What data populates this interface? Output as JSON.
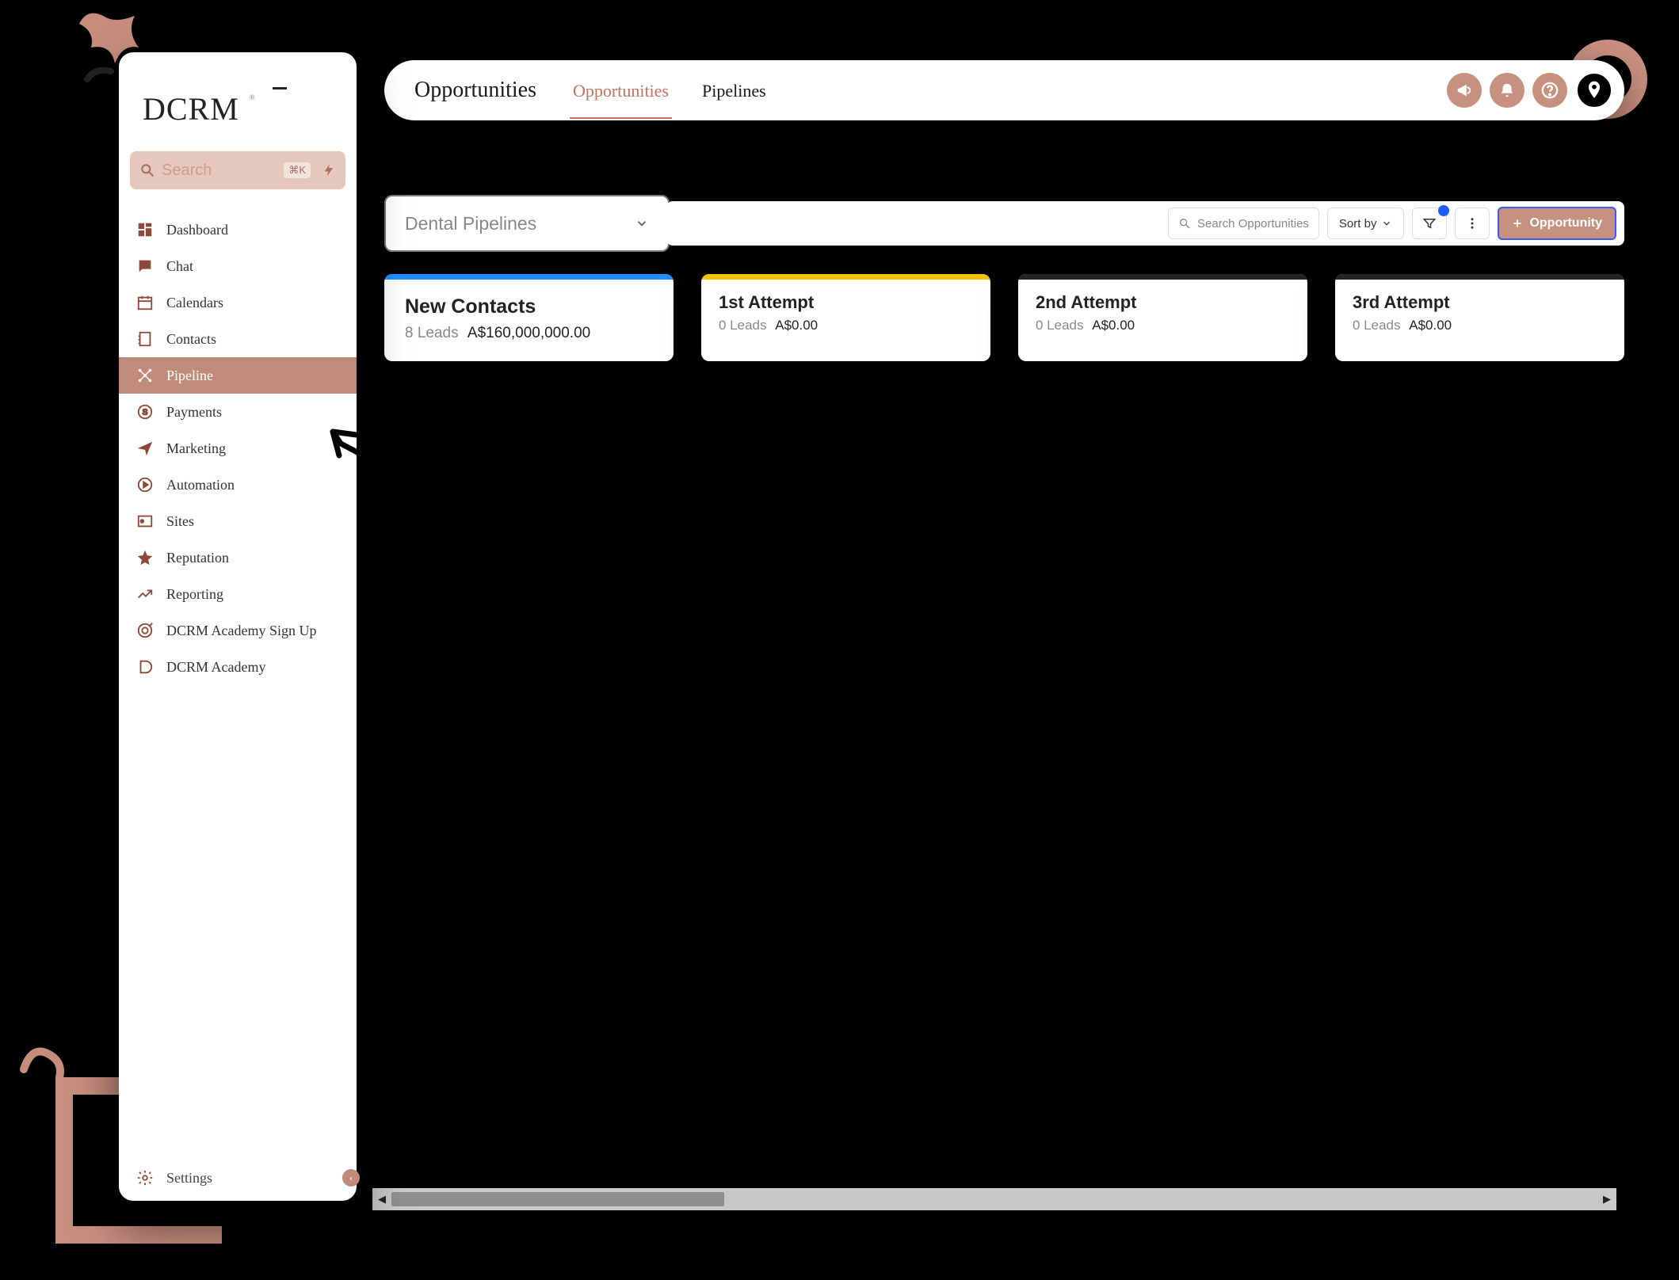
{
  "brand": "DCRM",
  "search": {
    "placeholder": "Search",
    "shortcut": "⌘K"
  },
  "sidebar": {
    "items": [
      {
        "label": "Dashboard"
      },
      {
        "label": "Chat"
      },
      {
        "label": "Calendars"
      },
      {
        "label": "Contacts"
      },
      {
        "label": "Pipeline"
      },
      {
        "label": "Payments"
      },
      {
        "label": "Marketing"
      },
      {
        "label": "Automation"
      },
      {
        "label": "Sites"
      },
      {
        "label": "Reputation"
      },
      {
        "label": "Reporting"
      },
      {
        "label": "DCRM Academy Sign Up"
      },
      {
        "label": "DCRM Academy"
      }
    ],
    "settings_label": "Settings"
  },
  "header": {
    "title": "Opportunities",
    "tabs": [
      {
        "label": "Opportunities",
        "active": true
      },
      {
        "label": "Pipelines",
        "active": false
      }
    ]
  },
  "toolbar": {
    "pipeline_select": "Dental Pipelines",
    "search_placeholder": "Search Opportunities",
    "sort_label": "Sort by",
    "add_label": "Opportunity"
  },
  "stages": [
    {
      "name": "New Contacts",
      "leads": "8 Leads",
      "value": "A$160,000,000.00",
      "color": "sel",
      "selected": true
    },
    {
      "name": "1st Attempt",
      "leads": "0 Leads",
      "value": "A$0.00",
      "color": "yellow",
      "selected": false
    },
    {
      "name": "2nd Attempt",
      "leads": "0 Leads",
      "value": "A$0.00",
      "color": "black",
      "selected": false
    },
    {
      "name": "3rd Attempt",
      "leads": "0 Leads",
      "value": "A$0.00",
      "color": "black",
      "selected": false
    }
  ]
}
